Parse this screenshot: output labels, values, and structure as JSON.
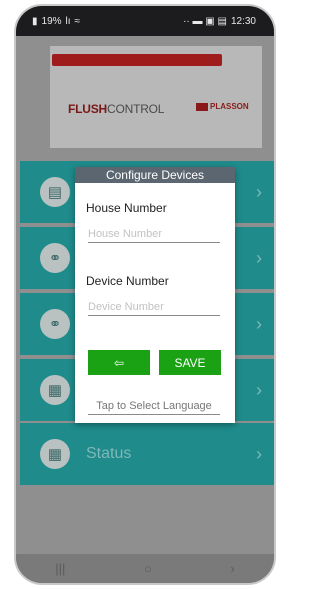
{
  "statusbar": {
    "battery": "19%",
    "signal": "lı",
    "wifi": "≈",
    "notifications": "·· ▬ ▣ ▤",
    "time": "12:30"
  },
  "logo": {
    "brand_bold": "FLUSH",
    "brand_rest": "CONTROL",
    "partner": "PLASSON"
  },
  "menu": {
    "items": [
      {
        "label": "",
        "icon": "clipboard-icon"
      },
      {
        "label": "",
        "icon": "link-icon"
      },
      {
        "label": "",
        "icon": "link-icon"
      },
      {
        "label": "",
        "icon": "calendar-icon"
      },
      {
        "label": "Status",
        "icon": "calendar-icon"
      }
    ],
    "chevron": "›"
  },
  "dialog": {
    "title": "Configure Devices",
    "house_label": "House Number",
    "house_placeholder": "House Number",
    "house_value": "",
    "device_label": "Device Number",
    "device_placeholder": "Device Number",
    "device_value": "",
    "back_label": "⇦",
    "save_label": "SAVE",
    "language_label": "Tap to Select Language"
  },
  "navbar": {
    "recents": "|||",
    "home": "○",
    "back": "›"
  },
  "colors": {
    "teal": "#1f8b8b",
    "green": "#1aa114",
    "dialog_title": "#5b6670",
    "brand_red": "#9e1c1c"
  }
}
